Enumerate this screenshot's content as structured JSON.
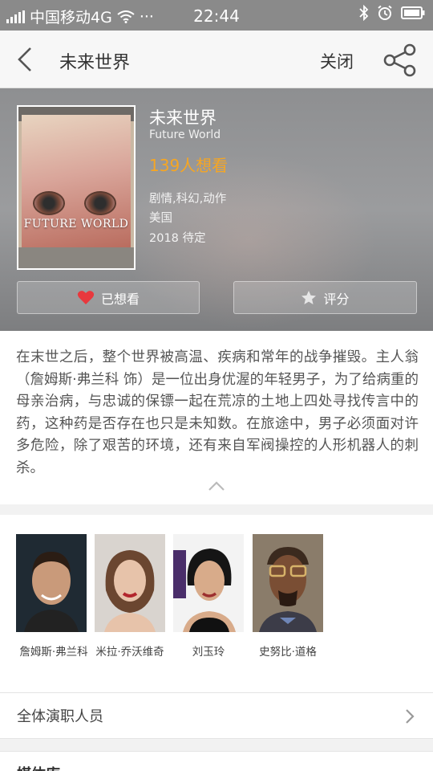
{
  "status_bar": {
    "carrier": "中国移动4G",
    "dots": "···",
    "time": "22:44"
  },
  "nav": {
    "title": "未来世界",
    "close_label": "关闭"
  },
  "movie": {
    "title": "未来世界",
    "english_title": "Future World",
    "want_count": "139人想看",
    "genre": "剧情,科幻,动作",
    "country": "美国",
    "release": "2018 待定",
    "poster_text": "FUTURE WORLD"
  },
  "actions": {
    "want_label": "已想看",
    "rate_label": "评分"
  },
  "synopsis": "在末世之后，整个世界被高温、疾病和常年的战争摧毁。主人翁（詹姆斯·弗兰科 饰）是一位出身优渥的年轻男子，为了给病重的母亲治病，与忠诚的保镖一起在荒凉的土地上四处寻找传言中的药，这种药是否存在也只是未知数。在旅途中，男子必须面对许多危险，除了艰苦的环境，还有来自军阀操控的人形机器人的刺杀。",
  "cast": [
    {
      "name": "詹姆斯·弗兰科"
    },
    {
      "name": "米拉·乔沃维奇"
    },
    {
      "name": "刘玉玲"
    },
    {
      "name": "史努比·道格"
    }
  ],
  "all_cast_label": "全体演职人员",
  "next_section_title": "媒体库",
  "colors": {
    "accent": "#f6a623",
    "heart": "#e8383d"
  }
}
